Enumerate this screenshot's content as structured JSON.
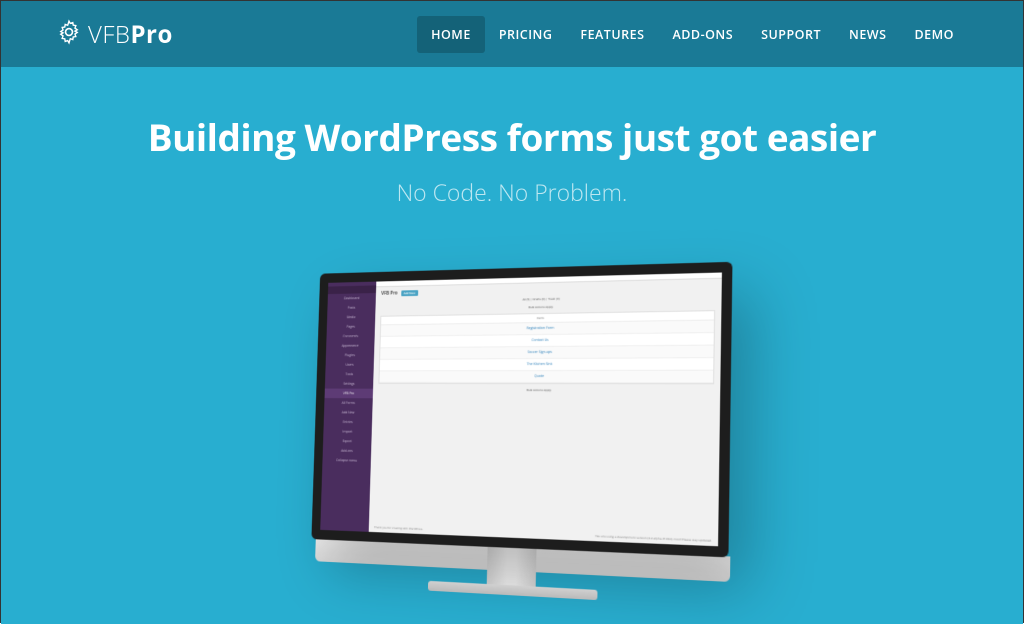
{
  "brand": {
    "prefix": "VFB",
    "suffix": "Pro"
  },
  "nav": {
    "items": [
      {
        "label": "HOME",
        "active": true
      },
      {
        "label": "PRICING",
        "active": false
      },
      {
        "label": "FEATURES",
        "active": false
      },
      {
        "label": "ADD-ONS",
        "active": false
      },
      {
        "label": "SUPPORT",
        "active": false
      },
      {
        "label": "NEWS",
        "active": false
      },
      {
        "label": "DEMO",
        "active": false
      }
    ]
  },
  "hero": {
    "title": "Building WordPress forms just got easier",
    "subtitle": "No Code. No Problem."
  },
  "screenshot": {
    "sidebar": [
      "Dashboard",
      "Posts",
      "Media",
      "Pages",
      "Comments",
      "Appearance",
      "Plugins",
      "Users",
      "Tools",
      "Settings",
      "VFB Pro",
      "All Forms",
      "Add New",
      "Entries",
      "Import",
      "Export",
      "Add-ons",
      "Collapse menu"
    ],
    "active_sidebar": "VFB Pro",
    "page_title": "VFB Pro",
    "add_new": "Add New",
    "filter_line": "All (5) | Drafts (0) | Trash (0)",
    "bulk": "Bulk Actions    Apply",
    "table_header": "Form",
    "rows": [
      "Registration Form",
      "Contact Us",
      "Soccer Sign-ups",
      "The Kitchen Sink",
      "Quote"
    ],
    "footer_left": "Thank you for creating with WordPress.",
    "footer_right": "You are using a development version (4.2-alpha-31492). Cool! Please stay updated."
  },
  "colors": {
    "header": "#1a7a96",
    "hero": "#28aed0",
    "nav_active": "#146278"
  }
}
